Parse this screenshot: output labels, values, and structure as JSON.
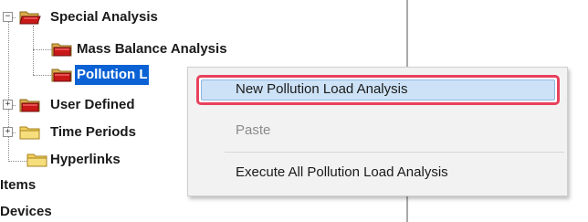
{
  "tree": {
    "special_analysis": "Special Analysis",
    "mass_balance": "Mass Balance Analysis",
    "pollution_load": "Pollution L",
    "user_defined": "User Defined",
    "time_periods": "Time Periods",
    "hyperlinks": "Hyperlinks",
    "items": "Items",
    "devices": "Devices"
  },
  "context_menu": {
    "new_pollution": "New Pollution Load Analysis",
    "paste": "Paste",
    "execute_all": "Execute All Pollution Load Analysis"
  },
  "colors": {
    "selection": "#0a62d4",
    "highlight_border": "#e8415c",
    "menu_hover": "#cde2f6"
  }
}
